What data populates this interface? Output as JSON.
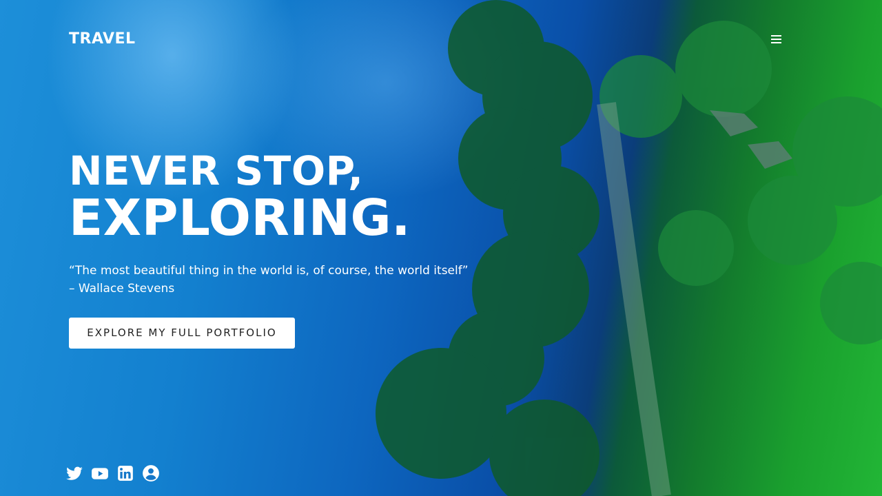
{
  "header": {
    "brand": "TRAVEL",
    "menu_icon": "hamburger-icon"
  },
  "hero": {
    "headline_line1": "NEVER STOP,",
    "headline_line2": "EXPLORING.",
    "quote_text": "“The most beautiful thing in the world is, of course, the world itself”",
    "quote_author": "– Wallace Stevens",
    "cta_label": "EXPLORE MY FULL PORTFOLIO"
  },
  "social": {
    "icons": [
      "twitter-icon",
      "youtube-icon",
      "linkedin-icon",
      "user-icon"
    ]
  },
  "colors": {
    "water": "#0d66bf",
    "foliage": "#1aa02e",
    "text": "#ffffff",
    "button_bg": "#ffffff",
    "button_text": "#222222"
  }
}
